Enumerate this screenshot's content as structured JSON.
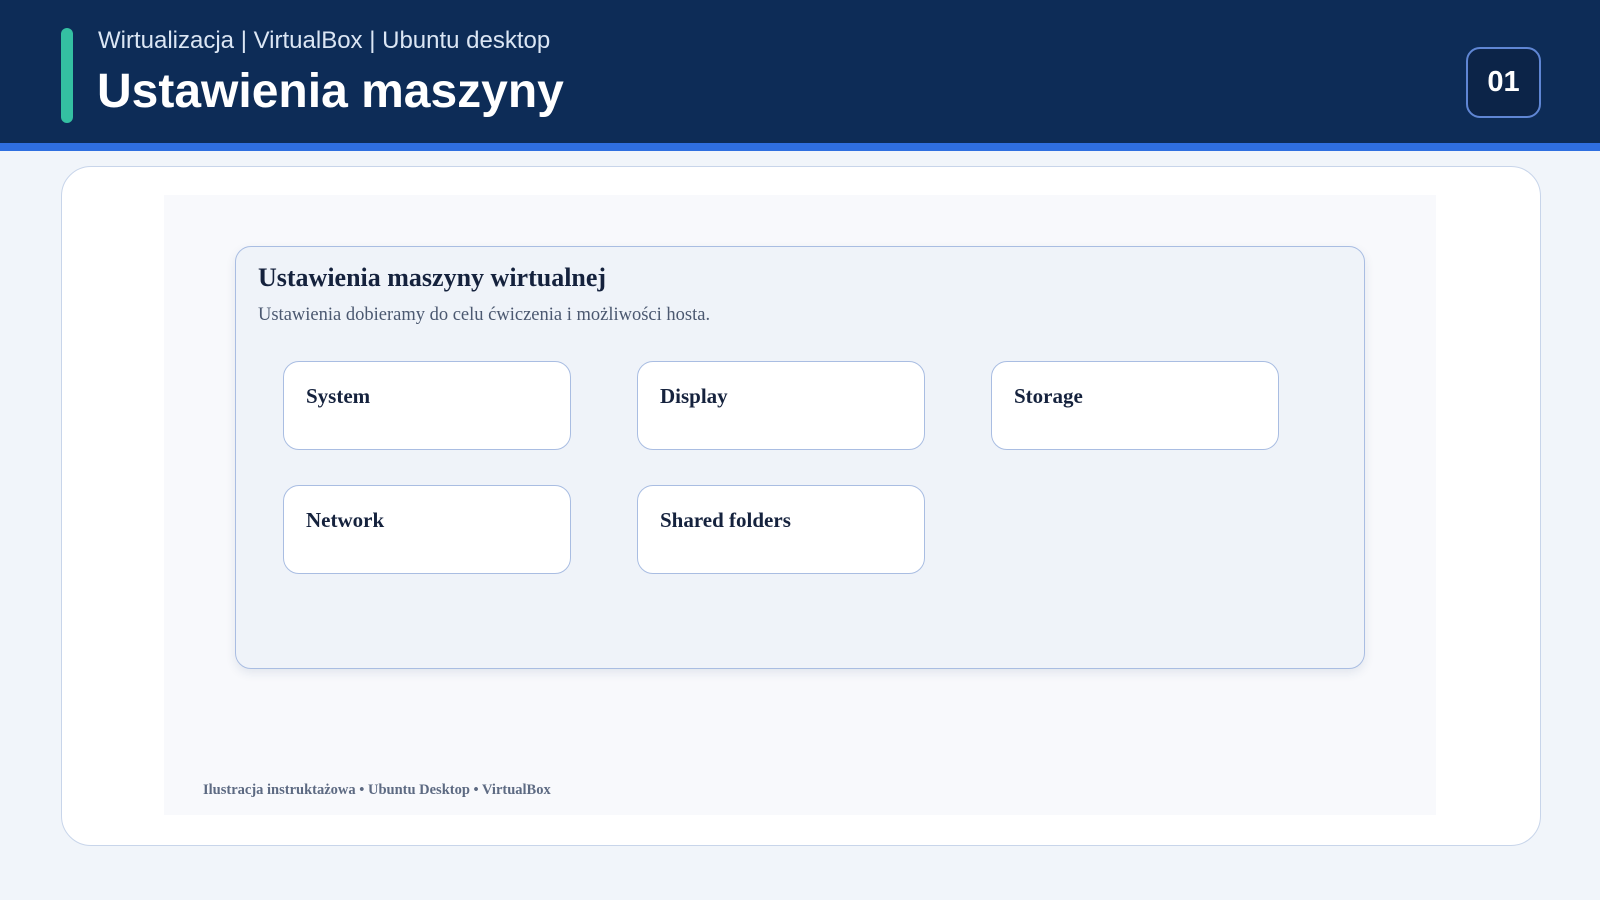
{
  "header": {
    "breadcrumb": "Wirtualizacja | VirtualBox | Ubuntu desktop",
    "title": "Ustawienia maszyny",
    "slide_number": "01"
  },
  "dialog": {
    "title": "Ustawienia maszyny wirtualnej",
    "subtitle": "Ustawienia dobieramy do celu ćwiczenia i możliwości hosta.",
    "tiles": [
      {
        "label": "System"
      },
      {
        "label": "Display"
      },
      {
        "label": "Storage"
      },
      {
        "label": "Network"
      },
      {
        "label": "Shared folders"
      }
    ]
  },
  "caption": "Ilustracja instruktażowa • Ubuntu Desktop • VirtualBox",
  "colors": {
    "header_bg": "#0d2c57",
    "header_stripe": "#2f6fe0",
    "accent": "#34c0a2",
    "page_bg": "#f1f5fa",
    "tile_border": "#a9bde2"
  }
}
